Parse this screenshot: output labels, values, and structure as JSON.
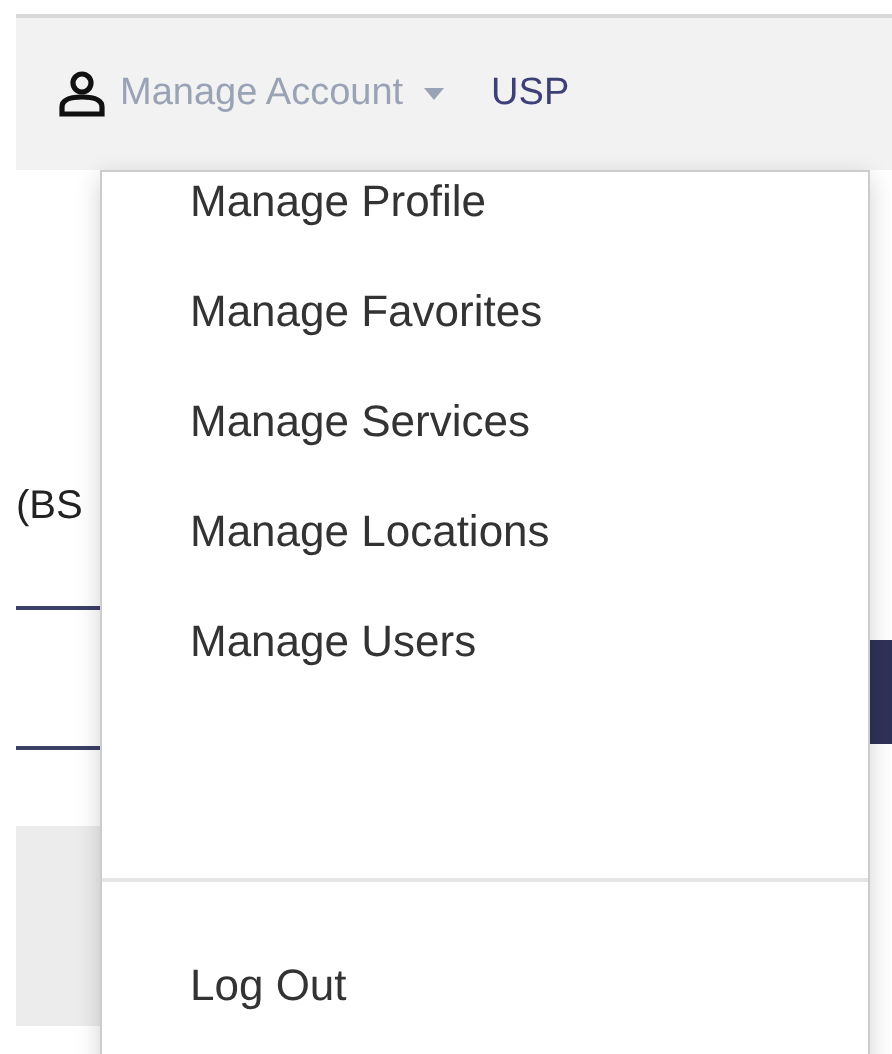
{
  "top_nav": [
    {
      "label": "Manage Account",
      "kind": "dropdown"
    },
    {
      "label": "USP",
      "kind": "link"
    }
  ],
  "background": {
    "heading_fragment": "(BS"
  },
  "menu": {
    "items": [
      "Manage Profile",
      "Manage Favorites",
      "Manage Services",
      "Manage Locations",
      "Manage Users"
    ],
    "footer_items": [
      "Log Out"
    ]
  }
}
